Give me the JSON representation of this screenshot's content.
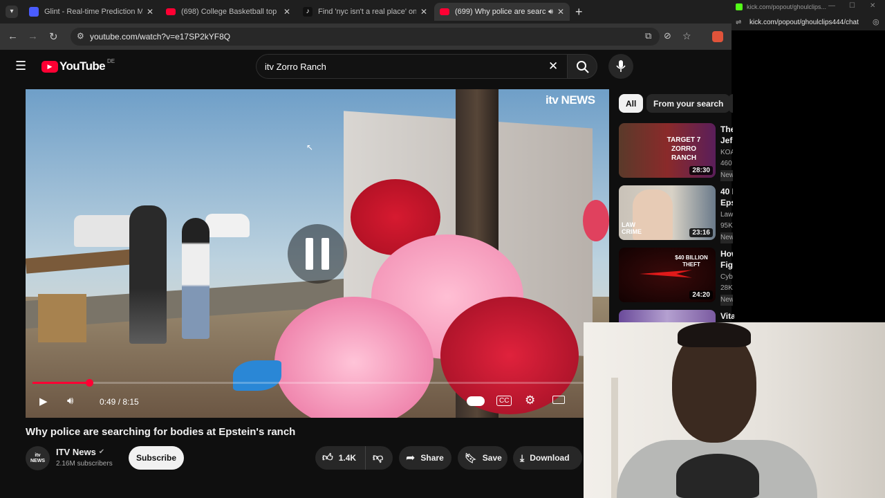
{
  "browser": {
    "tabs": [
      {
        "title": "Glint - Real-time Prediction Ma",
        "favicon_color": "#4a5cff"
      },
      {
        "title": "(698) College Basketball top pla",
        "favicon_color": "#ff0033"
      },
      {
        "title": "Find 'nyc isn't a real place' on T",
        "favicon_color": "#111111"
      },
      {
        "title": "(699) Why police are search",
        "favicon_color": "#ff0033",
        "active": true
      }
    ],
    "new_tab_icon": "plus-icon",
    "url": "youtube.com/watch?v=e17SP2kYF8Q"
  },
  "popout": {
    "title": "kick.com/popout/ghoulclips...",
    "url": "kick.com/popout/ghoulclips444/chat",
    "accent": "#53fc18"
  },
  "youtube": {
    "logo_text": "YouTube",
    "country": "DE",
    "search_value": "itv Zorro Ranch"
  },
  "video": {
    "watermark": "itv NEWS",
    "time": "0:49 / 8:15",
    "progress_fraction": 0.1,
    "state": "paused-overlay",
    "title": "Why police are searching for bodies at Epstein's ranch",
    "channel": "ITV News",
    "channel_avatar": "itv NEWS",
    "subscribers": "2.16M subscribers",
    "subscribe_label": "Subscribe",
    "likes": "1.4K",
    "share_label": "Share",
    "save_label": "Save",
    "download_label": "Download",
    "accent": "#ff0033"
  },
  "chips": [
    "All",
    "From your search"
  ],
  "recommended": [
    {
      "title": "The",
      "title2": "Jef",
      "channel": "KOA",
      "views": "460",
      "badge": "New",
      "duration": "28:30",
      "thumb_text": "TARGET 7 ZORRO RANCH"
    },
    {
      "title": "40 I",
      "title2": "Eps",
      "channel": "Law",
      "views": "95K",
      "badge": "New",
      "duration": "23:16",
      "thumb_text": "LAW CRIME"
    },
    {
      "title": "How",
      "title2": "Figh",
      "channel": "Cyb",
      "views": "28K",
      "badge": "New",
      "duration": "24:20",
      "thumb_text": "$40 BILLION THEFT"
    },
    {
      "title": "Vita",
      "duration": ""
    }
  ]
}
